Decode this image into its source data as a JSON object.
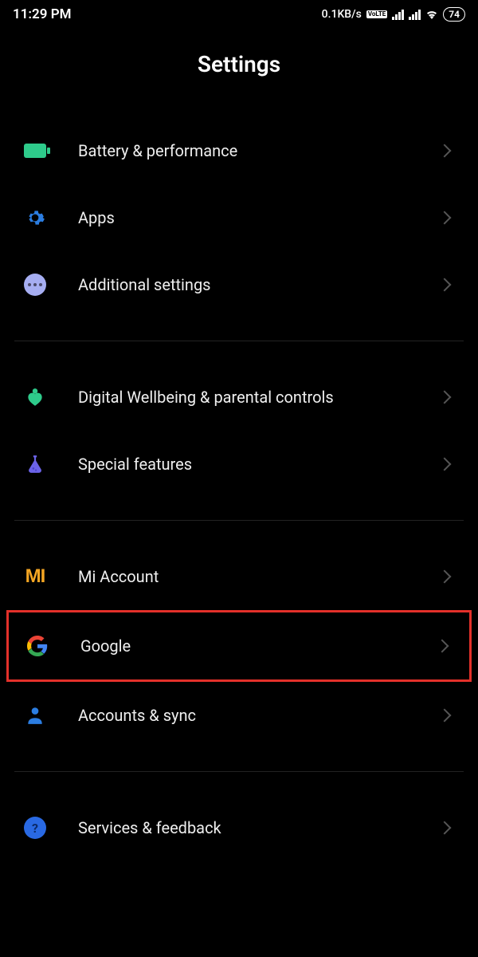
{
  "status_bar": {
    "time": "11:29 PM",
    "net_speed": "0.1KB/s",
    "volte": "VoLTE",
    "battery_level": "74"
  },
  "header": {
    "title": "Settings"
  },
  "groups": [
    {
      "items": [
        {
          "id": "battery-performance",
          "icon": "battery-icon",
          "label": "Battery & performance"
        },
        {
          "id": "apps",
          "icon": "gear-icon",
          "label": "Apps"
        },
        {
          "id": "additional-settings",
          "icon": "dots-icon",
          "label": "Additional settings"
        }
      ]
    },
    {
      "items": [
        {
          "id": "digital-wellbeing",
          "icon": "wellbeing-icon",
          "label": "Digital Wellbeing & parental controls"
        },
        {
          "id": "special-features",
          "icon": "flask-icon",
          "label": "Special features"
        }
      ]
    },
    {
      "items": [
        {
          "id": "mi-account",
          "icon": "mi-icon",
          "label": "Mi Account"
        },
        {
          "id": "google",
          "icon": "google-icon",
          "label": "Google",
          "highlighted": true
        },
        {
          "id": "accounts-sync",
          "icon": "person-icon",
          "label": "Accounts & sync"
        }
      ]
    },
    {
      "items": [
        {
          "id": "services-feedback",
          "icon": "help-icon",
          "label": "Services & feedback"
        }
      ]
    }
  ]
}
